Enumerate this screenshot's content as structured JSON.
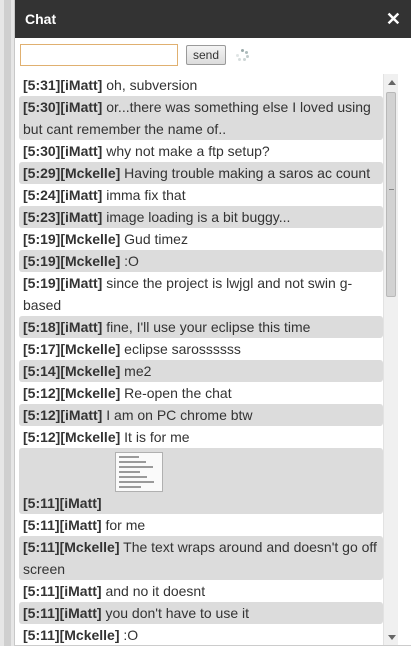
{
  "header": {
    "title": "Chat",
    "close_glyph": "✕"
  },
  "composer": {
    "input_value": "",
    "send_label": "send",
    "loading_icon": "spinner-icon"
  },
  "messages": [
    {
      "ts": "[5:31]",
      "user": "[iMatt]",
      "text": "oh, subversion"
    },
    {
      "ts": "[5:30]",
      "user": "[iMatt]",
      "text": "or...there was something else I loved using but cant remember the name of.."
    },
    {
      "ts": "[5:30]",
      "user": "[iMatt]",
      "text": "why not make a ftp setup?"
    },
    {
      "ts": "[5:29]",
      "user": "[Mckelle]",
      "text": "Having trouble making a saros ac count"
    },
    {
      "ts": "[5:24]",
      "user": "[iMatt]",
      "text": "imma fix that"
    },
    {
      "ts": "[5:23]",
      "user": "[iMatt]",
      "text": "image loading is a bit buggy..."
    },
    {
      "ts": "[5:19]",
      "user": "[Mckelle]",
      "text": "Gud timez"
    },
    {
      "ts": "[5:19]",
      "user": "[Mckelle]",
      "text": ":O"
    },
    {
      "ts": "[5:19]",
      "user": "[iMatt]",
      "text": "since the project is lwjgl and not swin g-based"
    },
    {
      "ts": "[5:18]",
      "user": "[iMatt]",
      "text": "fine, I'll use your eclipse this time"
    },
    {
      "ts": "[5:17]",
      "user": "[Mckelle]",
      "text": "eclipse sarossssss"
    },
    {
      "ts": "[5:14]",
      "user": "[Mckelle]",
      "text": "me2"
    },
    {
      "ts": "[5:12]",
      "user": "[Mckelle]",
      "text": "Re-open the chat"
    },
    {
      "ts": "[5:12]",
      "user": "[iMatt]",
      "text": "I am on PC chrome btw"
    },
    {
      "ts": "[5:12]",
      "user": "[Mckelle]",
      "text": "It is for me"
    },
    {
      "ts": "[5:11]",
      "user": "[iMatt]",
      "text": "",
      "image": "screenshot-thumbnail"
    },
    {
      "ts": "[5:11]",
      "user": "[iMatt]",
      "text": "for me"
    },
    {
      "ts": "[5:11]",
      "user": "[Mckelle]",
      "text": "The text wraps around and doesn't go off screen"
    },
    {
      "ts": "[5:11]",
      "user": "[iMatt]",
      "text": "and no it doesnt"
    },
    {
      "ts": "[5:11]",
      "user": "[iMatt]",
      "text": "you don't have to use it"
    },
    {
      "ts": "[5:11]",
      "user": "[Mckelle]",
      "text": ":O"
    }
  ]
}
